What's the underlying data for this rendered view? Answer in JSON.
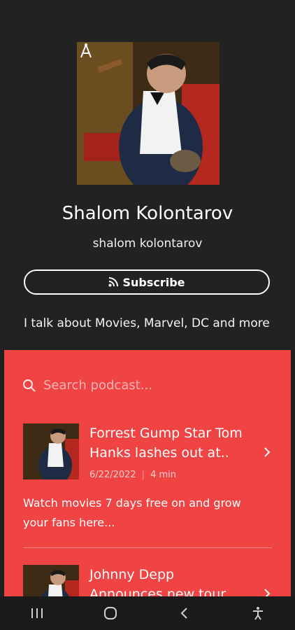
{
  "podcast": {
    "title": "Shalom Kolontarov",
    "author": "shalom kolontarov",
    "subscribe_label": "Subscribe",
    "description": "I talk about Movies, Marvel, DC and more",
    "cover_icon": "cover-art-image",
    "badge_icon": "anchor-podcast-icon"
  },
  "search": {
    "placeholder": "Search podcast..."
  },
  "episodes": [
    {
      "title": "Forrest Gump Star Tom Hanks lashes out at..",
      "date": "6/22/2022",
      "duration": "4 min",
      "description": "Watch movies 7 days free on and grow your fans here..."
    },
    {
      "title": "Johnny Depp Announces new tour",
      "date": "",
      "duration": "",
      "description": ""
    }
  ],
  "colors": {
    "background": "#222222",
    "panel": "#f04343",
    "navbar": "#1a1a1a"
  }
}
